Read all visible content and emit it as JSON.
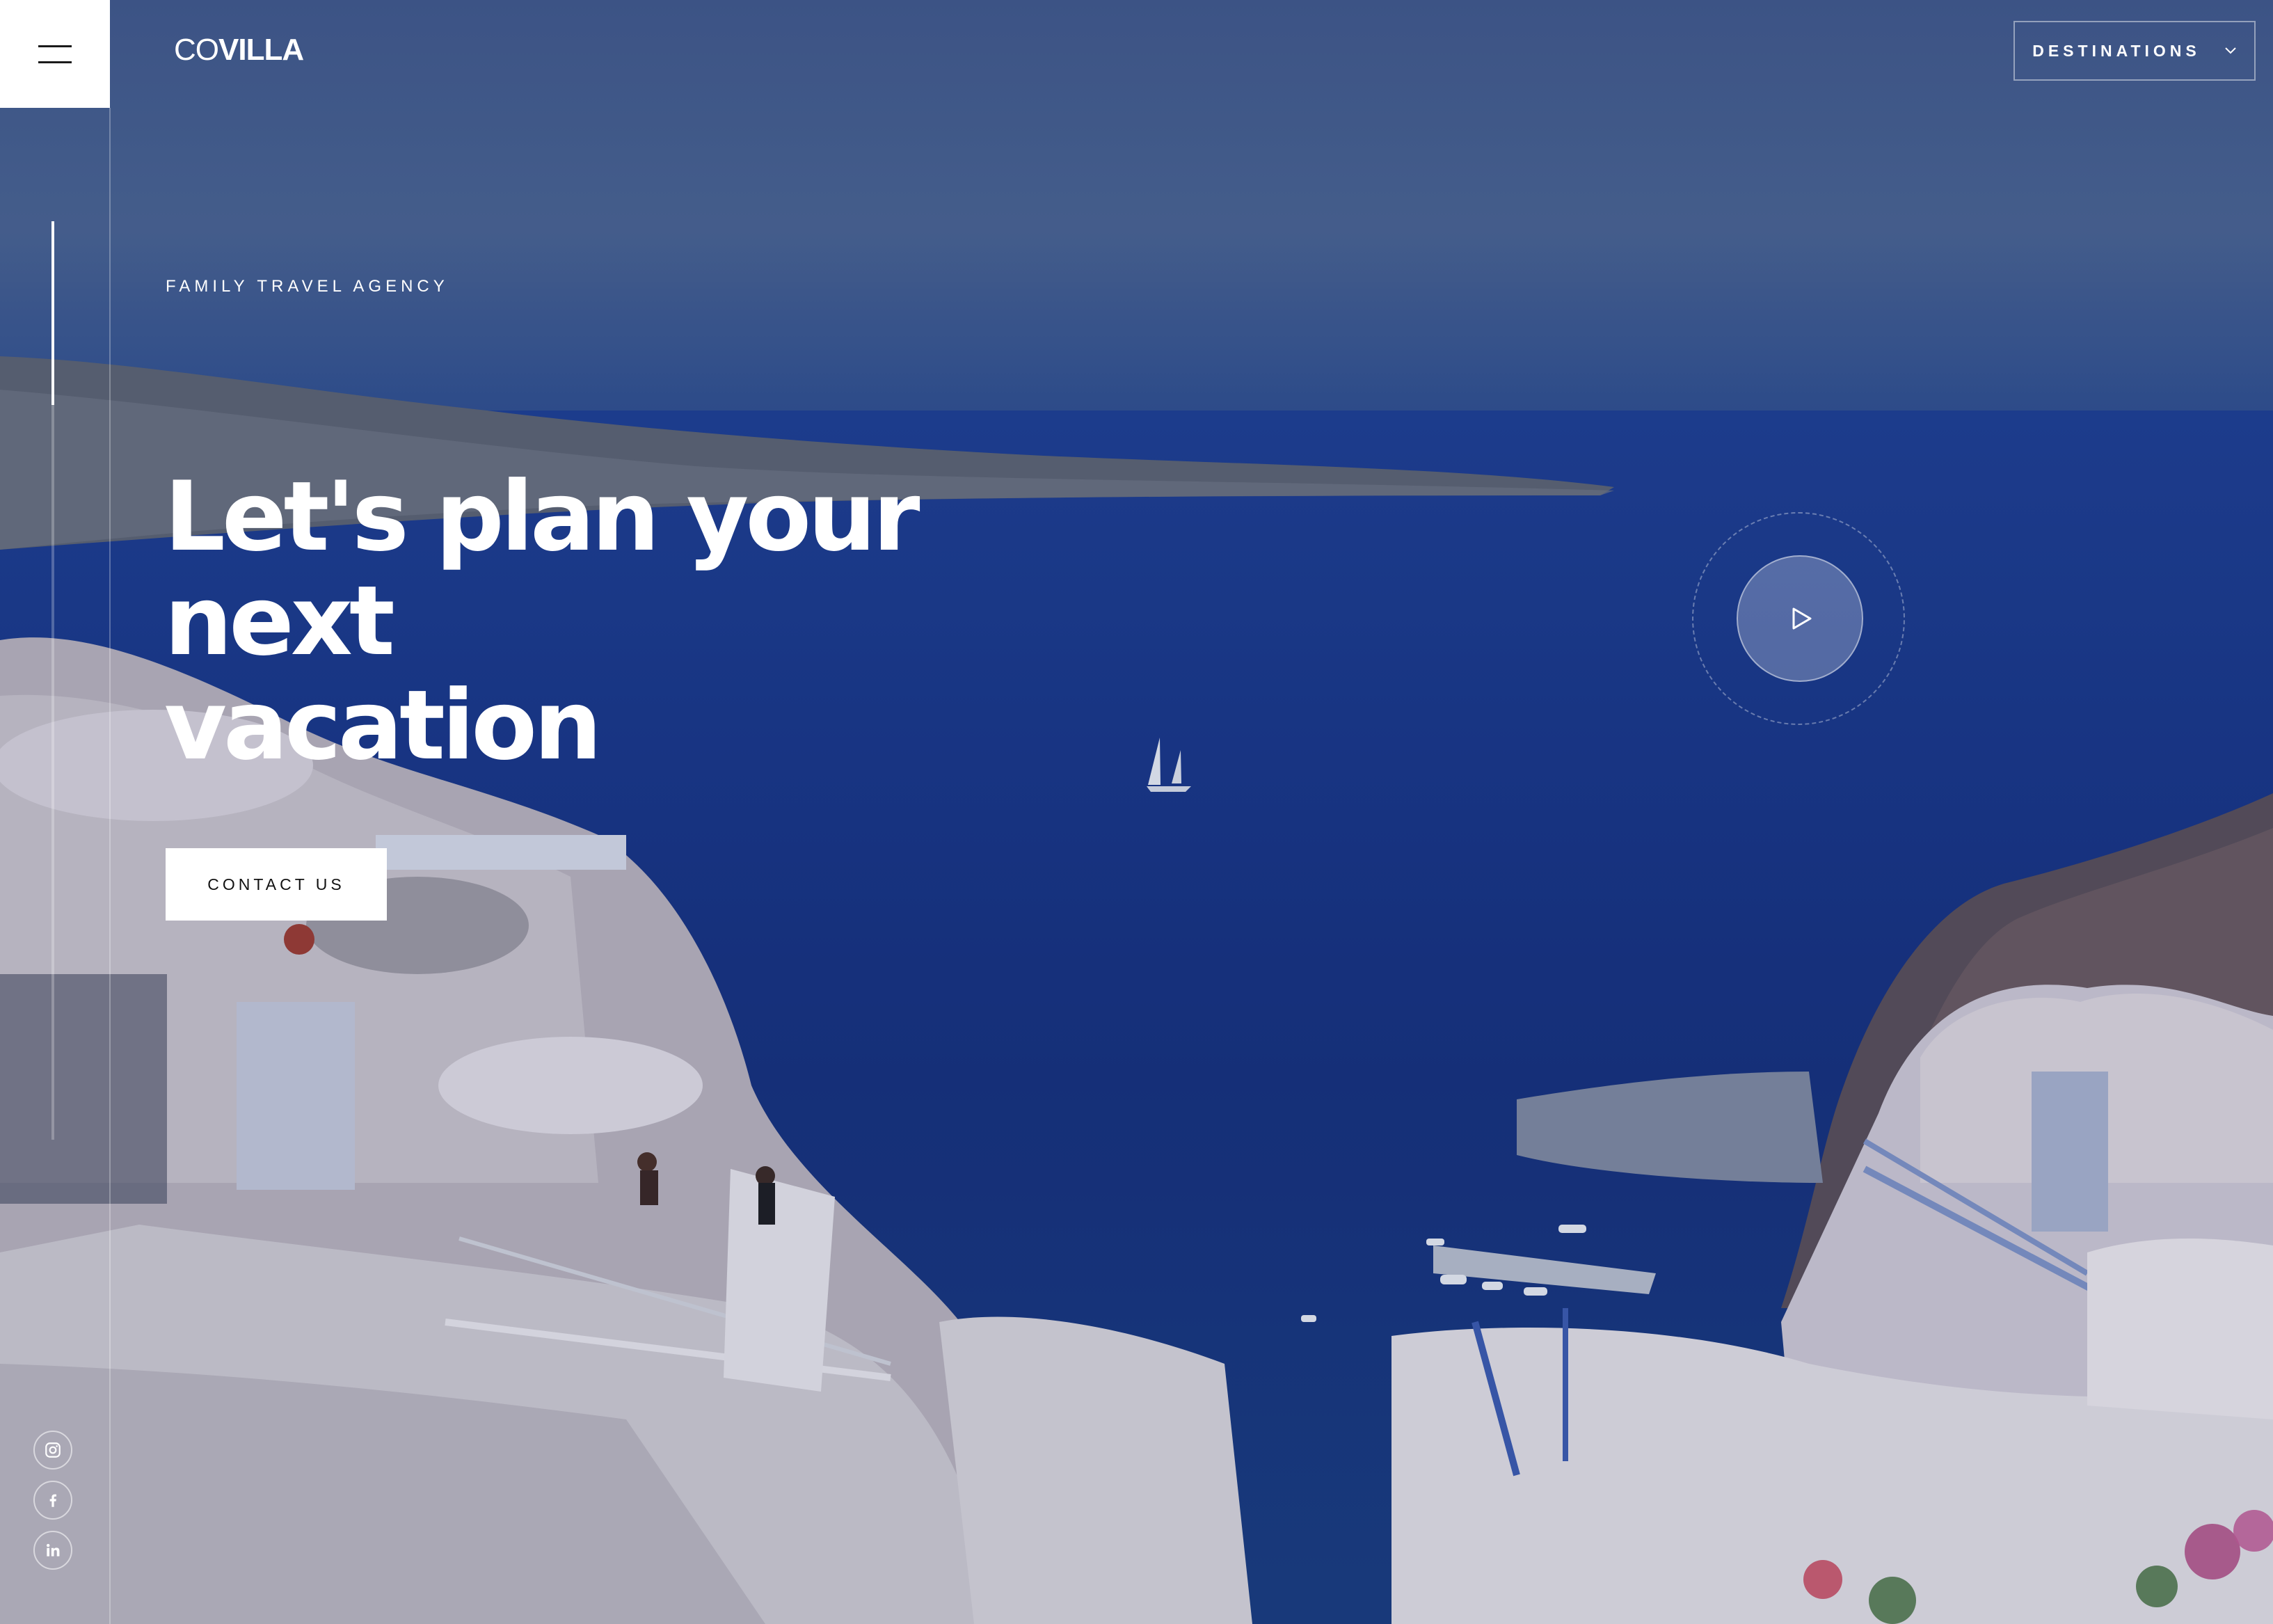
{
  "brand": {
    "logo_light": "CO",
    "logo_bold": "VILLA"
  },
  "header": {
    "menu_icon": "hamburger-menu-icon",
    "destinations_label": "DESTINATIONS",
    "destinations_icon": "chevron-down-icon"
  },
  "hero": {
    "eyebrow": "FAMILY TRAVEL AGENCY",
    "headline_line1": "Let's plan your next",
    "headline_line2": "vacation",
    "cta_label": "CONTACT US",
    "play_icon": "play-icon",
    "background": "aerial photo of white cliffside village above deep blue sea with sailboat"
  },
  "social": [
    {
      "name": "instagram",
      "icon": "instagram-icon"
    },
    {
      "name": "facebook",
      "icon": "facebook-icon"
    },
    {
      "name": "linkedin",
      "icon": "linkedin-icon"
    }
  ],
  "colors": {
    "sea": "#1a3888",
    "sky": "#4a6392",
    "accent": "#ffffff",
    "cta_text": "#111111"
  }
}
